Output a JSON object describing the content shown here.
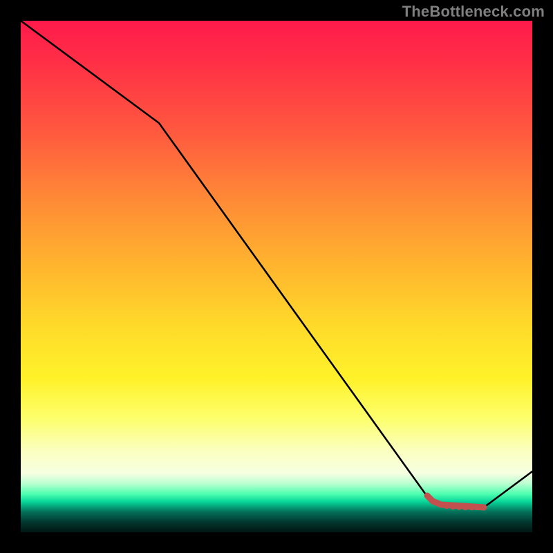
{
  "watermark": "TheBottleneck.com",
  "chart_data": {
    "type": "line",
    "x": [
      0,
      0.27,
      0.79,
      0.8,
      0.81,
      0.82,
      0.83,
      0.84,
      0.85,
      0.86,
      0.87,
      0.88,
      0.89,
      0.9,
      0.905,
      1.0
    ],
    "values": [
      1.0,
      0.8,
      0.075,
      0.065,
      0.058,
      0.052,
      0.05,
      0.049,
      0.049,
      0.049,
      0.049,
      0.049,
      0.049,
      0.049,
      0.049,
      0.12
    ],
    "title": "",
    "xlabel": "",
    "ylabel": "",
    "xlim": [
      0,
      1
    ],
    "ylim": [
      0,
      1
    ],
    "series": [
      {
        "name": "main-curve",
        "color": "#000000"
      },
      {
        "name": "highlight-band",
        "color": "#c1504e"
      }
    ]
  },
  "colors": {
    "highlight": "#c1504e",
    "line": "#000000",
    "watermark": "#7f7f7f",
    "background": "#000000"
  }
}
